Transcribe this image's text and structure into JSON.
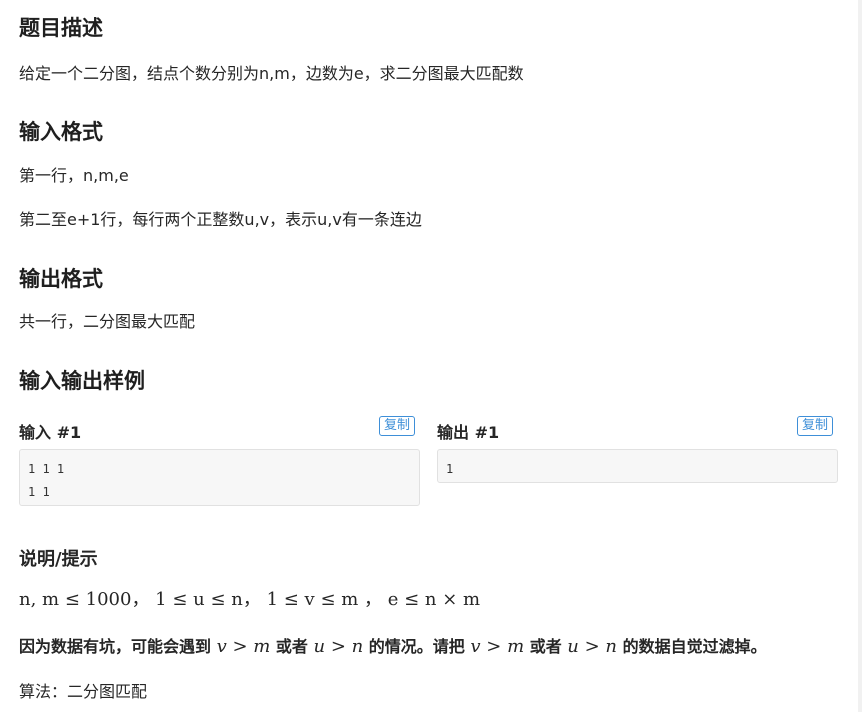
{
  "sections": {
    "description": {
      "title": "题目描述",
      "text": "给定一个二分图，结点个数分别为n,m，边数为e，求二分图最大匹配数"
    },
    "input_format": {
      "title": "输入格式",
      "line1": "第一行，n,m,e",
      "line2": "第二至e+1行，每行两个正整数u,v，表示u,v有一条连边"
    },
    "output_format": {
      "title": "输出格式",
      "line1": "共一行，二分图最大匹配"
    },
    "samples": {
      "title": "输入输出样例",
      "input": {
        "label": "输入 #1",
        "copy_label": "复制",
        "lines": [
          "1 1 1",
          "1 1"
        ]
      },
      "output": {
        "label": "输出 #1",
        "copy_label": "复制",
        "lines": [
          "1"
        ]
      }
    },
    "hint": {
      "title": "说明/提示",
      "constraints": "n, m ≤ 1000，  1 ≤ u ≤ n，  1 ≤ v ≤ m ，  e ≤ n × m",
      "note_part1": "因为数据有坑，可能会遇到 ",
      "note_math1": "v > m",
      "note_part2": " 或者 ",
      "note_math2": "u > n",
      "note_part3": " 的情况。请把 ",
      "note_math3": "v > m",
      "note_part4": " 或者 ",
      "note_math4": "u > n",
      "note_part5": " 的数据自觉过滤掉。",
      "algorithm": "算法：二分图匹配"
    }
  }
}
